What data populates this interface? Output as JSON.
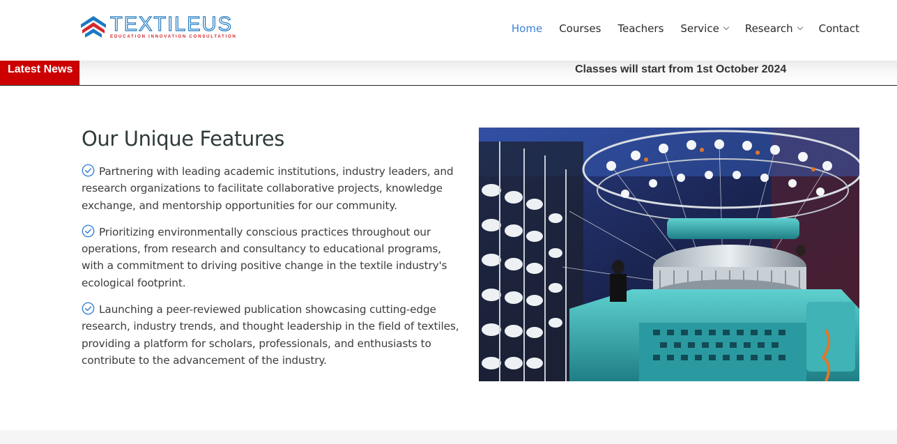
{
  "brand": {
    "name": "TEXTILEUS",
    "tagline": "EDUCATION INNOVATION CONSULTATION",
    "colors": {
      "blue": "#1d78c1",
      "red": "#d6262b"
    }
  },
  "nav": {
    "items": [
      {
        "label": "Home",
        "active": true
      },
      {
        "label": "Courses"
      },
      {
        "label": "Teachers"
      },
      {
        "label": "Service",
        "dropdown": true
      },
      {
        "label": "Research",
        "dropdown": true
      },
      {
        "label": "Contact"
      }
    ],
    "active_color": "#3b82d6"
  },
  "news": {
    "label": "Latest News",
    "text": "Classes will start from 1st October 2024",
    "label_color": "#cc0000"
  },
  "features": {
    "title": "Our Unique Features",
    "icon": "check-circle-icon",
    "items": [
      "Partnering with leading academic institutions, industry leaders, and research organizations to facilitate collaborative projects, knowledge exchange, and mentorship opportunities for our community.",
      "Prioritizing environmentally conscious practices throughout our operations, from research and consultancy to educational programs, with a commitment to driving positive change in the textile industry's ecological footprint.",
      "Launching a peer-reviewed publication showcasing cutting-edge research, industry trends, and thought leadership in the field of textiles, providing a platform for scholars, professionals, and enthusiasts to contribute to the advancement of the industry."
    ]
  }
}
